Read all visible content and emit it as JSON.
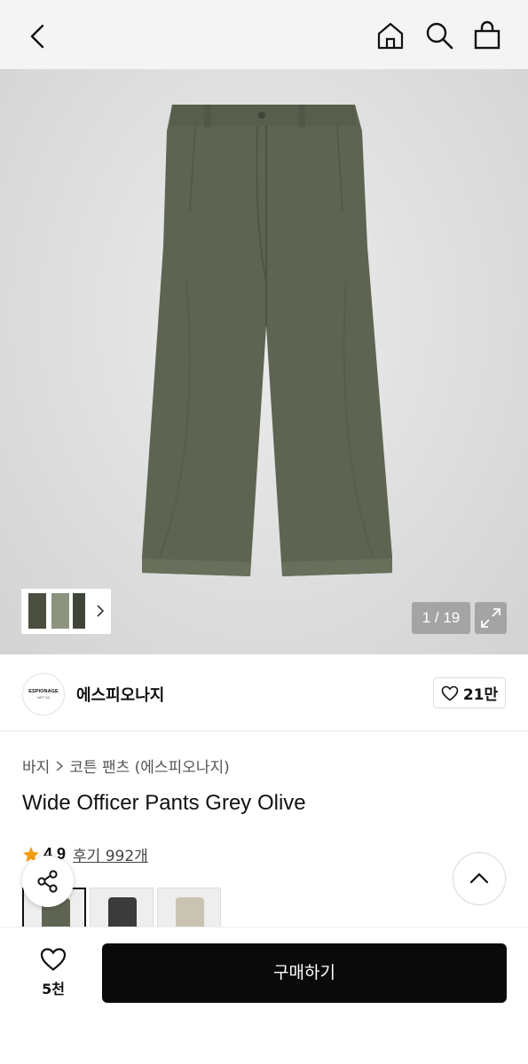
{
  "nav": {
    "icons": [
      "back-icon",
      "home-icon",
      "search-icon",
      "shopping-bag-icon"
    ]
  },
  "gallery": {
    "counter": "1 / 19",
    "current_image": 1,
    "total_images": 19
  },
  "brand": {
    "logo_line1": "ESPIONAGE",
    "logo_line2": "NET 98",
    "name": "에스피오나지",
    "like_count": "21만"
  },
  "breadcrumb": {
    "category": "바지",
    "subcategory": "코튼 팬츠 (에스피오나지)"
  },
  "product": {
    "title": "Wide Officer Pants Grey Olive",
    "rating": "4.9",
    "review_label": "후기 992개",
    "swatch_colors": [
      "#5f6552",
      "#3a3b3a",
      "#c9c3b3"
    ]
  },
  "bottom": {
    "wish_count": "5천",
    "buy_label": "구매하기"
  },
  "colors": {
    "product_olive": "#5d6451",
    "star": "#f39c12",
    "buy_bg": "#0a0a0a"
  }
}
